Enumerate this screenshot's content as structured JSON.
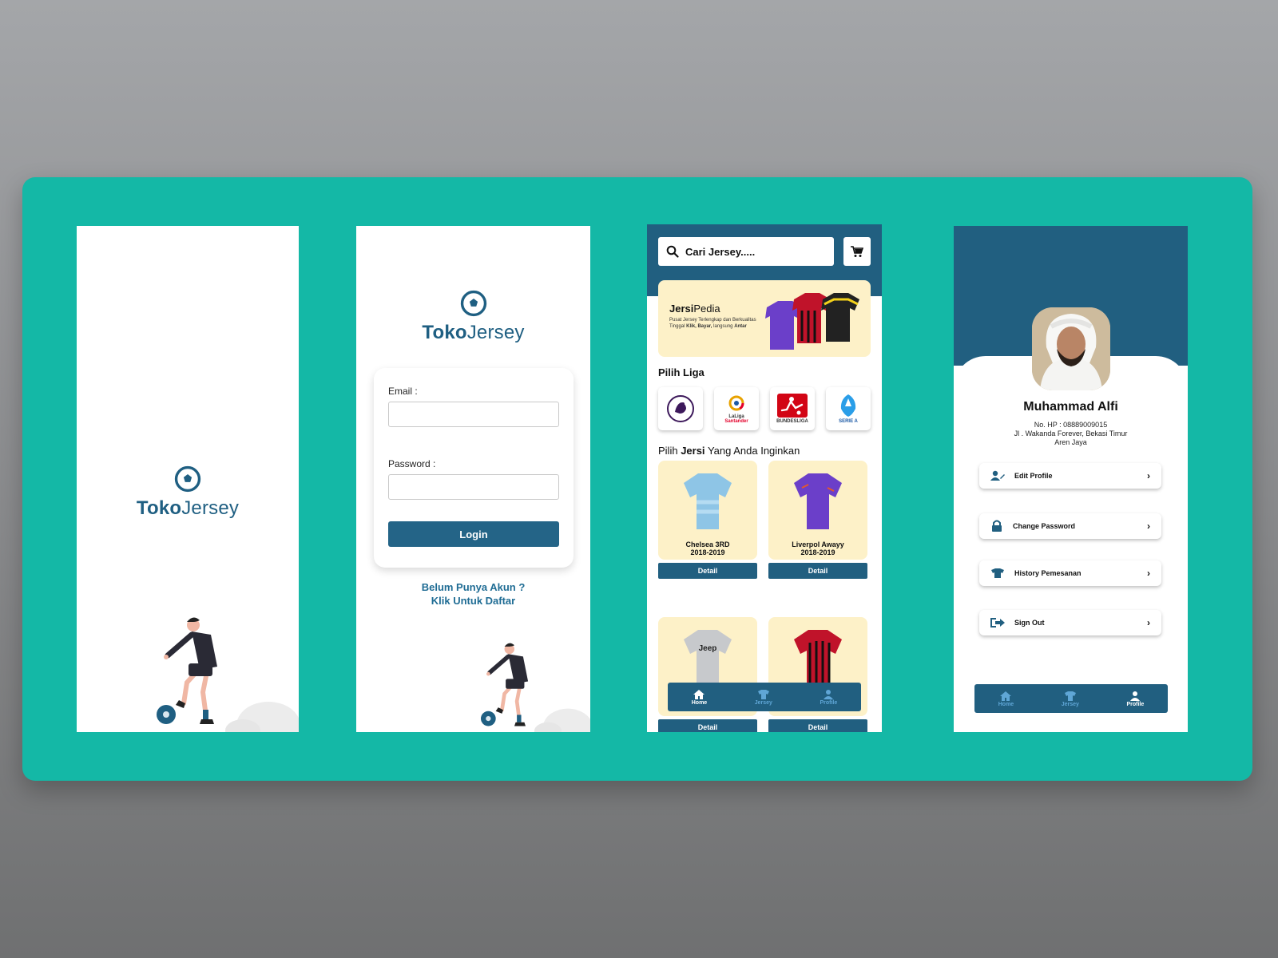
{
  "colors": {
    "board": "#14b8a6",
    "primary": "#215f80",
    "card_bg": "#fdf1c8",
    "link": "#1f6c94"
  },
  "splash": {
    "brand_bold": "Toko",
    "brand_regular": "Jersey"
  },
  "login": {
    "brand_bold": "Toko",
    "brand_regular": "Jersey",
    "email_label": "Email :",
    "email_value": "",
    "password_label": "Password :",
    "password_value": "",
    "login_label": "Login",
    "signup_line1": "Belum Punya Akun ?",
    "signup_line2": "Klik Untuk Daftar"
  },
  "home": {
    "search_placeholder": "Cari Jersey.....",
    "banner": {
      "title_bold": "Jersi",
      "title_regular": "Pedia",
      "desc1": "Pusat Jersey Terlengkap dan Berkualitas",
      "desc2_prefix": "Tinggal ",
      "desc2_bold1": "Klik, Bayar,",
      "desc2_mid": " langsung ",
      "desc2_bold2": "Antar"
    },
    "pilih_liga": "Pilih Liga",
    "leagues": [
      {
        "name": "Premier League",
        "icon": "premier-league-logo"
      },
      {
        "name": "LaLiga Santander",
        "icon": "laliga-logo",
        "text1": "LaLiga",
        "text2": "Santander"
      },
      {
        "name": "Bundesliga",
        "icon": "bundesliga-logo",
        "text1": "BUNDESLIGA"
      },
      {
        "name": "Serie A",
        "icon": "serie-a-logo",
        "text1": "SERIE A"
      }
    ],
    "jersey_section_prefix": "Pilih ",
    "jersey_section_bold": "Jersi",
    "jersey_section_suffix": " Yang Anda Inginkan",
    "jerseys": [
      {
        "line1": "Chelsea 3RD",
        "line2": "2018-2019",
        "detail": "Detail"
      },
      {
        "line1": "Liverpol Awayy",
        "line2": "2018-2019",
        "detail": "Detail"
      },
      {
        "line1": "",
        "line2": "",
        "detail": "Detail"
      },
      {
        "line1": "",
        "line2": "",
        "detail": "Detail"
      }
    ],
    "nav": {
      "home": "Home",
      "jersey": "Jersey",
      "profile": "Profile",
      "active": "home"
    }
  },
  "profile": {
    "name": "Muhammad Alfi",
    "phone_line": "No. HP :  08889009015",
    "address_line1": "Jl . Wakanda Forever, Bekasi Timur",
    "address_line2": "Aren Jaya",
    "menu": [
      {
        "label": "Edit Profile",
        "icon": "user-edit-icon"
      },
      {
        "label": "Change Password",
        "icon": "lock-icon"
      },
      {
        "label": "History Pemesanan",
        "icon": "shirt-icon"
      },
      {
        "label": "Sign Out",
        "icon": "sign-out-icon"
      }
    ],
    "nav": {
      "home": "Home",
      "jersey": "Jersey",
      "profile": "Profile",
      "active": "profile"
    }
  }
}
